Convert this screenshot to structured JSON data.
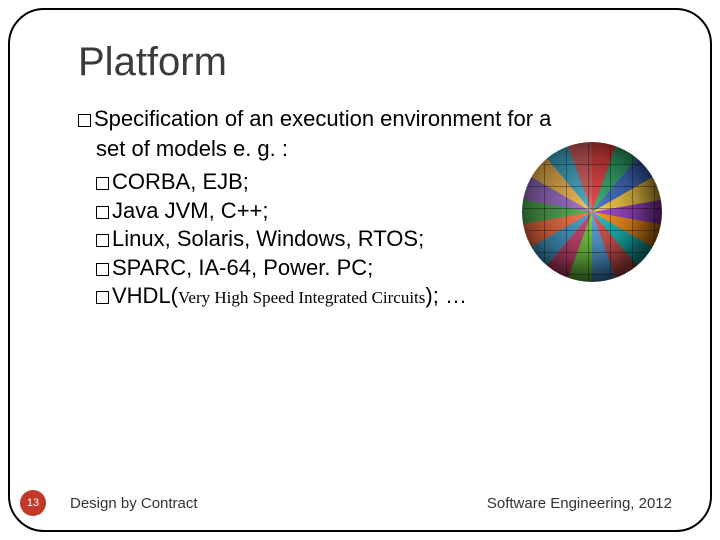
{
  "title": "Platform",
  "main_bullet_a": "Specification of an execution environment for a",
  "main_bullet_b": "set of models e. g. :",
  "subs": {
    "s1": "CORBA, EJB;",
    "s2": "Java JVM, C++;",
    "s3": "Linux, Solaris, Windows, RTOS;",
    "s4": "SPARC, IA-64, Power. PC;",
    "s5a": "VHDL(",
    "s5b": "Very High Speed Integrated Circuits",
    "s5c": "); …"
  },
  "page_number": "13",
  "footer_left": "Design by Contract",
  "footer_right": "Software Engineering, 2012"
}
